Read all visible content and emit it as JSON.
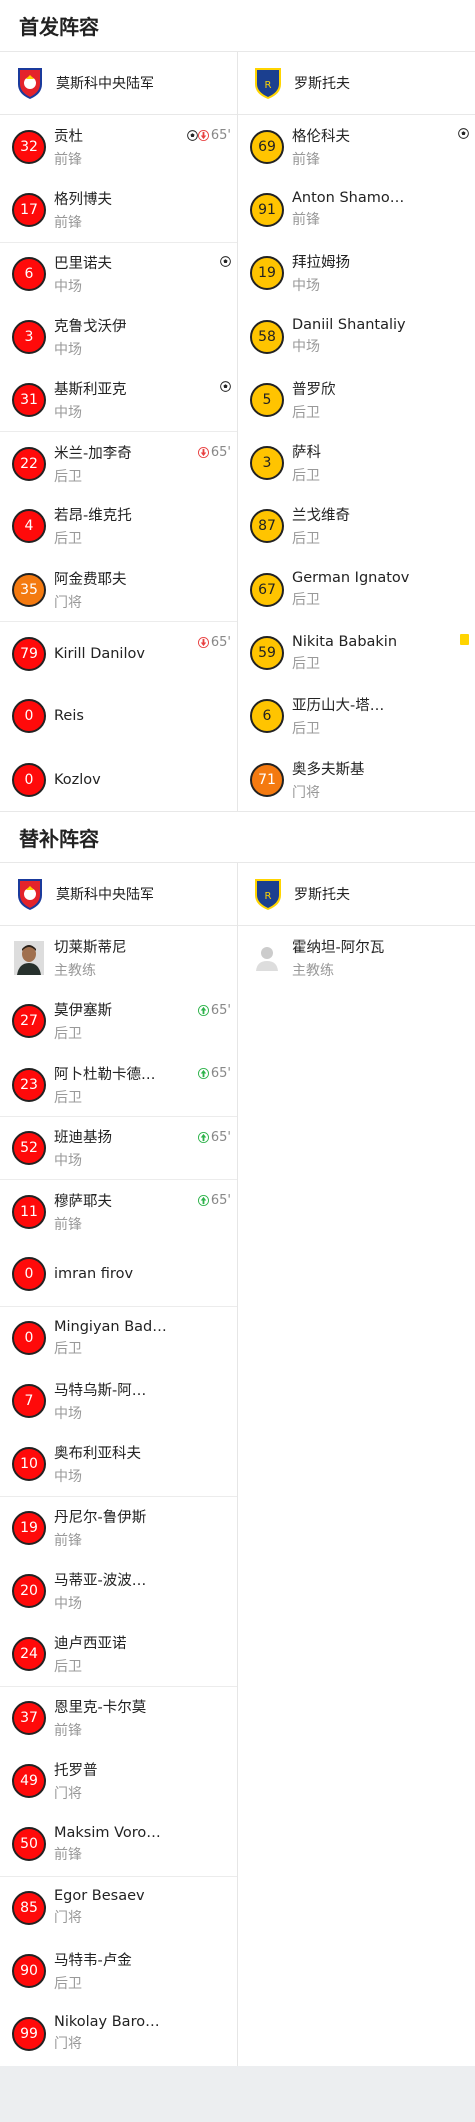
{
  "starting": {
    "title": "首发阵容",
    "home_team": "莫斯科中央陆军",
    "away_team": "罗斯托夫",
    "home": [
      {
        "num": "32",
        "name": "贡杜",
        "pos": "前锋",
        "color": "red",
        "events": [
          "ball",
          "sub-off"
        ],
        "minute": "65'"
      },
      {
        "num": "17",
        "name": "格列博夫",
        "pos": "前锋",
        "color": "red"
      },
      {
        "num": "6",
        "name": "巴里诺夫",
        "pos": "中场",
        "color": "red",
        "events": [
          "ball"
        ],
        "sep": true
      },
      {
        "num": "3",
        "name": "克鲁戈沃伊",
        "pos": "中场",
        "color": "red"
      },
      {
        "num": "31",
        "name": "基斯利亚克",
        "pos": "中场",
        "color": "red",
        "events": [
          "ball"
        ]
      },
      {
        "num": "22",
        "name": "米兰-加李奇",
        "pos": "后卫",
        "color": "red",
        "events": [
          "sub-off"
        ],
        "minute": "65'",
        "sep": true
      },
      {
        "num": "4",
        "name": "若昂-维克托",
        "pos": "后卫",
        "color": "red"
      },
      {
        "num": "35",
        "name": "阿金费耶夫",
        "pos": "门将",
        "color": "orange"
      },
      {
        "num": "79",
        "name": "Kirill Danilov",
        "pos": "",
        "color": "red",
        "events": [
          "sub-off"
        ],
        "minute": "65'",
        "sep": true
      },
      {
        "num": "0",
        "name": "Reis",
        "pos": "",
        "color": "red"
      },
      {
        "num": "0",
        "name": "Kozlov",
        "pos": "",
        "color": "red"
      }
    ],
    "away": [
      {
        "num": "69",
        "name": "格伦科夫",
        "pos": "前锋",
        "color": "yellow",
        "events": [
          "ball"
        ]
      },
      {
        "num": "91",
        "name": "Anton Shamo…",
        "pos": "前锋",
        "color": "yellow"
      },
      {
        "num": "19",
        "name": "拜拉姆扬",
        "pos": "中场",
        "color": "yellow"
      },
      {
        "num": "58",
        "name": "Daniil Shantaliy",
        "pos": "中场",
        "color": "yellow"
      },
      {
        "num": "5",
        "name": "普罗欣",
        "pos": "后卫",
        "color": "yellow"
      },
      {
        "num": "3",
        "name": "萨科",
        "pos": "后卫",
        "color": "yellow"
      },
      {
        "num": "87",
        "name": "兰戈维奇",
        "pos": "后卫",
        "color": "yellow"
      },
      {
        "num": "67",
        "name": "German Ignatov",
        "pos": "后卫",
        "color": "yellow"
      },
      {
        "num": "59",
        "name": "Nikita Babakin",
        "pos": "后卫",
        "color": "yellow",
        "events": [
          "yellow-card"
        ]
      },
      {
        "num": "6",
        "name": "亚历山大-塔…",
        "pos": "后卫",
        "color": "yellow"
      },
      {
        "num": "71",
        "name": "奥多夫斯基",
        "pos": "门将",
        "color": "orange"
      }
    ]
  },
  "subs": {
    "title": "替补阵容",
    "home_team": "莫斯科中央陆军",
    "away_team": "罗斯托夫",
    "home_coach": {
      "name": "切莱斯蒂尼",
      "role": "主教练"
    },
    "away_coach": {
      "name": "霍纳坦-阿尔瓦",
      "role": "主教练"
    },
    "home": [
      {
        "num": "27",
        "name": "莫伊塞斯",
        "pos": "后卫",
        "color": "red",
        "events": [
          "sub-on"
        ],
        "minute": "65'"
      },
      {
        "num": "23",
        "name": "阿卜杜勒卡德…",
        "pos": "后卫",
        "color": "red",
        "events": [
          "sub-on"
        ],
        "minute": "65'"
      },
      {
        "num": "52",
        "name": "班迪基扬",
        "pos": "中场",
        "color": "red",
        "events": [
          "sub-on"
        ],
        "minute": "65'",
        "sep": true
      },
      {
        "num": "11",
        "name": "穆萨耶夫",
        "pos": "前锋",
        "color": "red",
        "events": [
          "sub-on"
        ],
        "minute": "65'",
        "sep": true
      },
      {
        "num": "0",
        "name": "imran firov",
        "pos": "",
        "color": "red"
      },
      {
        "num": "0",
        "name": "Mingiyan Bad…",
        "pos": "后卫",
        "color": "red",
        "sep": true
      },
      {
        "num": "7",
        "name": "马特乌斯-阿…",
        "pos": "中场",
        "color": "red"
      },
      {
        "num": "10",
        "name": "奥布利亚科夫",
        "pos": "中场",
        "color": "red"
      },
      {
        "num": "19",
        "name": "丹尼尔-鲁伊斯",
        "pos": "前锋",
        "color": "red",
        "sep": true
      },
      {
        "num": "20",
        "name": "马蒂亚-波波…",
        "pos": "中场",
        "color": "red"
      },
      {
        "num": "24",
        "name": "迪卢西亚诺",
        "pos": "后卫",
        "color": "red"
      },
      {
        "num": "37",
        "name": "恩里克-卡尔莫",
        "pos": "前锋",
        "color": "red",
        "sep": true
      },
      {
        "num": "49",
        "name": "托罗普",
        "pos": "门将",
        "color": "red"
      },
      {
        "num": "50",
        "name": "Maksim Voro…",
        "pos": "前锋",
        "color": "red"
      },
      {
        "num": "85",
        "name": "Egor Besaev",
        "pos": "门将",
        "color": "red",
        "sep": true
      },
      {
        "num": "90",
        "name": "马特韦-卢金",
        "pos": "后卫",
        "color": "red"
      },
      {
        "num": "99",
        "name": "Nikolay Baro…",
        "pos": "门将",
        "color": "red"
      }
    ]
  },
  "colors": {
    "red": "#ff0a0a",
    "yellow": "#ffc400",
    "orange": "#f47a10",
    "sub_on": "#2db34a",
    "sub_off": "#e84040"
  }
}
